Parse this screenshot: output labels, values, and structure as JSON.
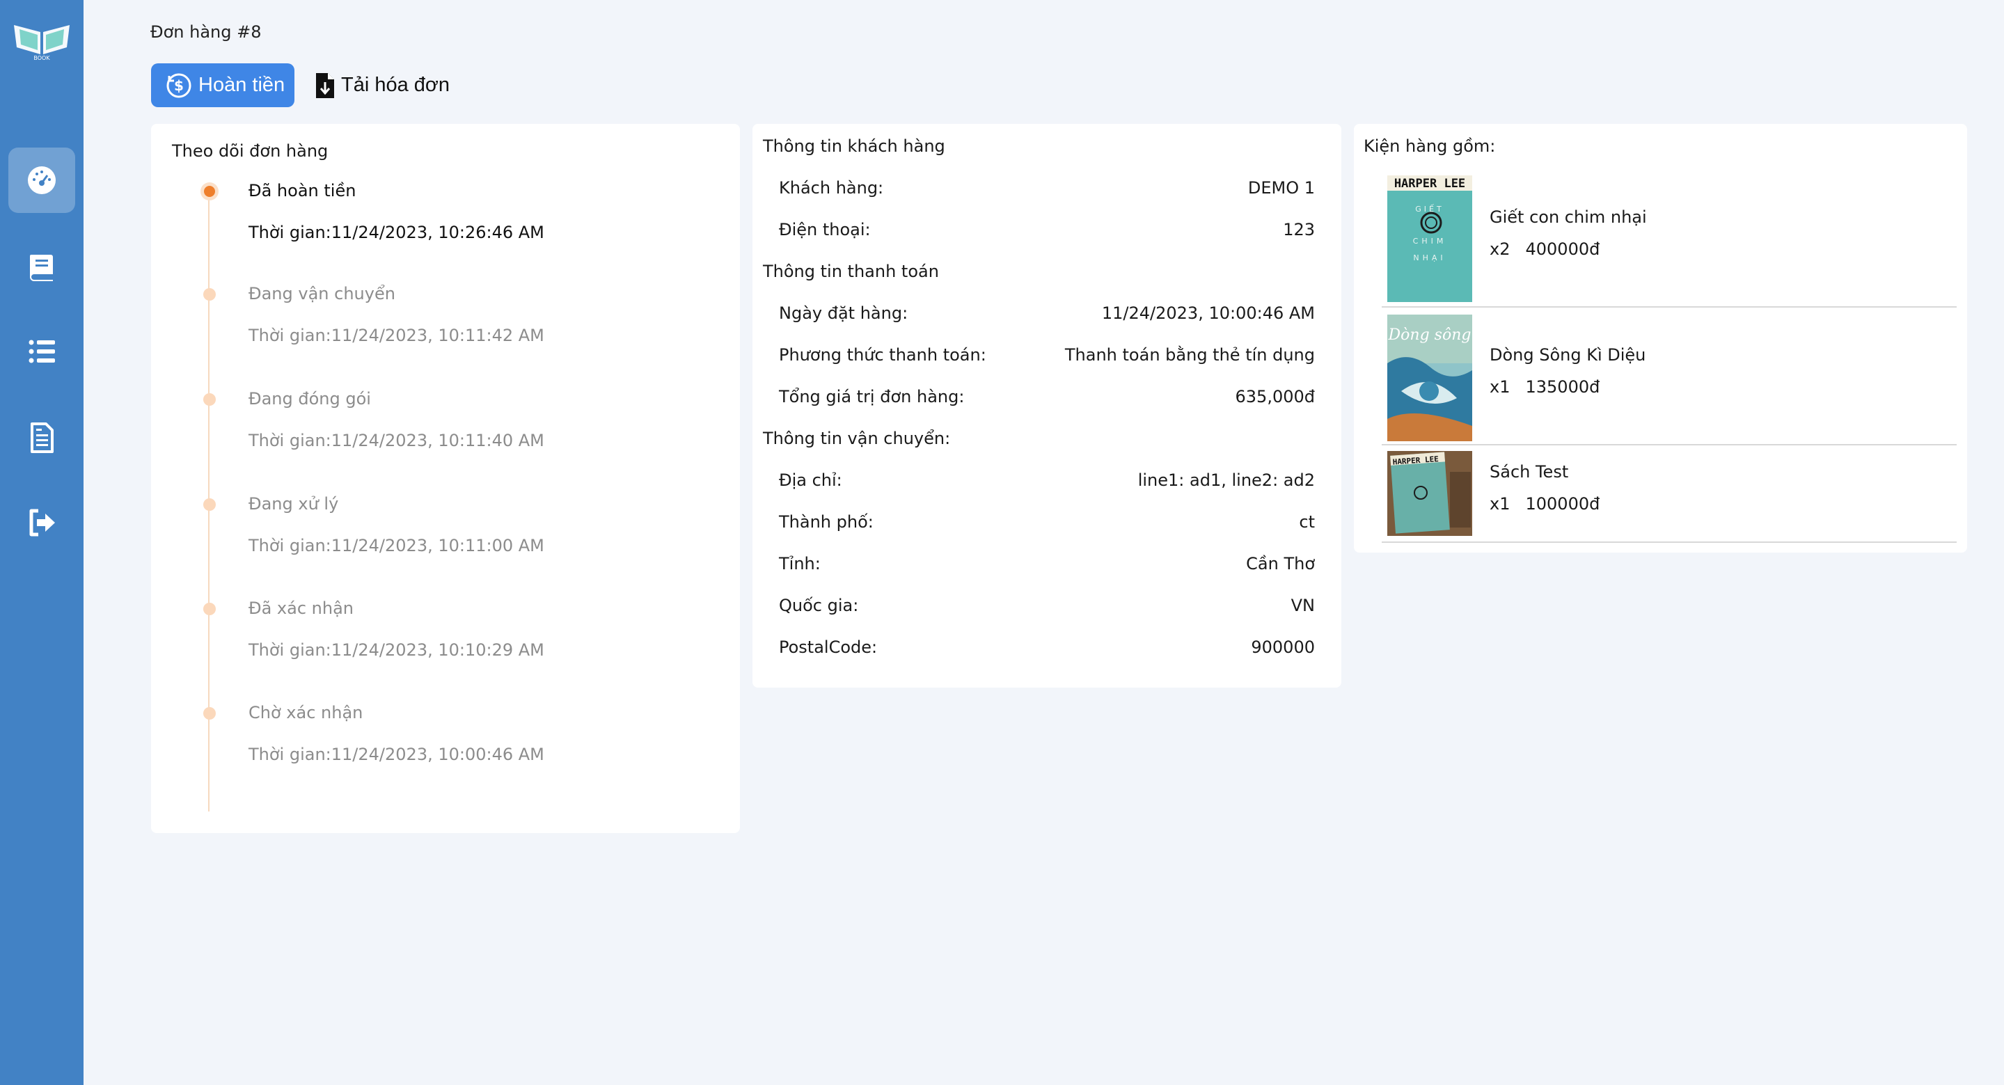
{
  "sidebar": {
    "logo_text": "BOOK",
    "items": [
      {
        "icon": "dashboard-icon",
        "active": true
      },
      {
        "icon": "book-icon",
        "active": false
      },
      {
        "icon": "list-icon",
        "active": false
      },
      {
        "icon": "document-icon",
        "active": false
      },
      {
        "icon": "logout-icon",
        "active": false
      }
    ]
  },
  "header": {
    "title": "Đơn hàng #8",
    "refund_label": "Hoàn tiền",
    "invoice_label": "Tải hóa đơn"
  },
  "tracking": {
    "title": "Theo dõi đơn hàng",
    "steps": [
      {
        "status": "Đã hoàn tiền",
        "time": "Thời gian:11/24/2023, 10:26:46 AM"
      },
      {
        "status": "Đang vận chuyển",
        "time": "Thời gian:11/24/2023, 10:11:42 AM"
      },
      {
        "status": "Đang đóng gói",
        "time": "Thời gian:11/24/2023, 10:11:40 AM"
      },
      {
        "status": "Đang xử lý",
        "time": "Thời gian:11/24/2023, 10:11:00 AM"
      },
      {
        "status": "Đã xác nhận",
        "time": "Thời gian:11/24/2023, 10:10:29 AM"
      },
      {
        "status": "Chờ xác nhận",
        "time": "Thời gian:11/24/2023, 10:00:46 AM"
      }
    ]
  },
  "customer": {
    "title": "Thông tin khách hàng",
    "rows": [
      {
        "label": "Khách hàng:",
        "value": "DEMO 1"
      },
      {
        "label": "Điện thoại:",
        "value": "123"
      }
    ]
  },
  "payment": {
    "title": "Thông tin thanh toán",
    "rows": [
      {
        "label": "Ngày đặt hàng:",
        "value": "11/24/2023, 10:00:46 AM"
      },
      {
        "label": "Phương thức thanh toán:",
        "value": "Thanh toán bằng thẻ tín dụng"
      },
      {
        "label": "Tổng giá trị đơn hàng:",
        "value": "635,000đ"
      }
    ]
  },
  "shipping": {
    "title": "Thông tin vận chuyển:",
    "rows": [
      {
        "label": "Địa chỉ:",
        "value": "line1: ad1, line2: ad2"
      },
      {
        "label": "Thành phố:",
        "value": "ct"
      },
      {
        "label": "Tỉnh:",
        "value": "Cần Thơ"
      },
      {
        "label": "Quốc gia:",
        "value": "VN"
      },
      {
        "label": "PostalCode:",
        "value": "900000"
      }
    ]
  },
  "package": {
    "title": "Kiện hàng gồm:",
    "items": [
      {
        "name": "Giết con chim nhại",
        "qty": "x2",
        "price": "400000đ",
        "cover_author": "HARPER LEE",
        "cover_title": "GIẾT CON CHIM NHẠI"
      },
      {
        "name": "Dòng Sông Kì Diệu",
        "qty": "x1",
        "price": "135000đ",
        "cover_title": "Dòng sông"
      },
      {
        "name": "Sách Test",
        "qty": "x1",
        "price": "100000đ",
        "cover_author": "HARPER LEE"
      }
    ]
  },
  "colors": {
    "sidebar": "#4282c5",
    "primary_button": "#3f86e6",
    "timeline_active": "#ee7f2c",
    "timeline_past": "#fbd8bb"
  }
}
